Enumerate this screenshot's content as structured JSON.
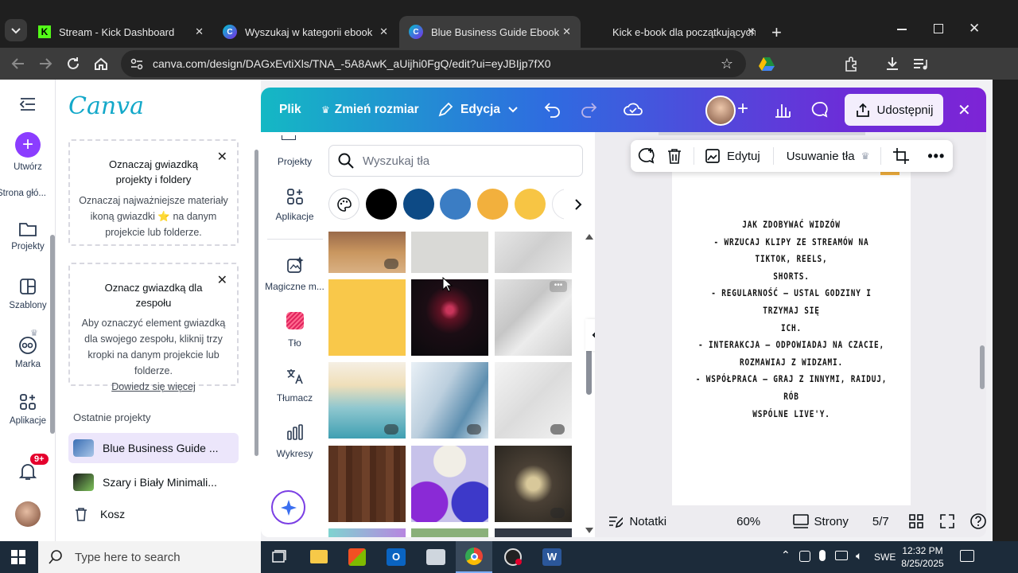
{
  "browser": {
    "tabs": [
      {
        "title": "Stream - Kick Dashboard"
      },
      {
        "title": "Wyszukaj w kategorii ebook ter"
      },
      {
        "title": "Blue Business Guide Ebook – O"
      },
      {
        "title": "Kick e-book dla początkujących"
      }
    ],
    "url": "canva.com/design/DAGxEvtiXls/TNA_-5A8AwK_aUijhi0FgQ/edit?ui=eyJBIjp7fX0"
  },
  "left_rail": {
    "create_label": "Utwórz",
    "home_label": "Strona głó...",
    "projects_label": "Projekty",
    "templates_label": "Szablony",
    "brand_label": "Marka",
    "apps_label": "Aplikacje",
    "notification_count": "9+"
  },
  "side_panel": {
    "logo": "Canva",
    "card1": {
      "title": "Oznaczaj gwiazdką projekty i foldery",
      "body": "Oznaczaj najważniejsze materiały ikoną gwiazdki ⭐ na danym projekcie lub folderze."
    },
    "card2": {
      "title": "Oznacz gwiazdką dla zespołu",
      "body": "Aby oznaczyć element gwiazdką dla swojego zespołu, kliknij trzy kropki na danym projekcie lub folderze.",
      "link": "Dowiedz się więcej"
    },
    "recent_heading": "Ostatnie projekty",
    "recent": [
      {
        "name": "Blue Business Guide ..."
      },
      {
        "name": "Szary i Biały Minimali..."
      }
    ],
    "trash_label": "Kosz"
  },
  "editor": {
    "menu_file": "Plik",
    "menu_resize": "Zmień rozmiar",
    "menu_edit": "Edycja",
    "share_label": "Udostępnij",
    "tools": [
      {
        "label": "Projekty"
      },
      {
        "label": "Aplikacje"
      },
      {
        "label": "Magiczne m..."
      },
      {
        "label": "Tło"
      },
      {
        "label": "Tłumacz"
      },
      {
        "label": "Wykresy"
      }
    ],
    "search_placeholder": "Wyszukaj tła",
    "swatches": [
      "#000000",
      "#0d4a85",
      "#3b7dc4",
      "#f2b03d",
      "#f7c544"
    ],
    "context_toolbar": {
      "edit_label": "Edytuj",
      "remove_bg_label": "Usuwanie tła"
    },
    "page_text": [
      "JAK ZDOBYWAĆ WIDZÓW",
      "- WRZUCAJ KLIPY ZE STREAMÓW NA TIKTOK, REELS,",
      "SHORTS.",
      "- REGULARNOŚĆ – USTAL GODZINY I TRZYMAJ SIĘ",
      "ICH.",
      "- INTERAKCJA – ODPOWIADAJ NA CZACIE,",
      "ROZMAWIAJ Z WIDZAMI.",
      "- WSPÓŁPRACA – GRAJ Z INNYMI, RAIDUJ, RÓB",
      "WSPÓLNE LIVE'Y."
    ],
    "footer": {
      "notes_label": "Notatki",
      "zoom": "60%",
      "pages_label": "Strony",
      "page_counter": "5/7"
    }
  },
  "taskbar": {
    "search_placeholder": "Type here to search",
    "language": "SWE",
    "time": "12:32 PM",
    "date": "8/25/2025"
  }
}
